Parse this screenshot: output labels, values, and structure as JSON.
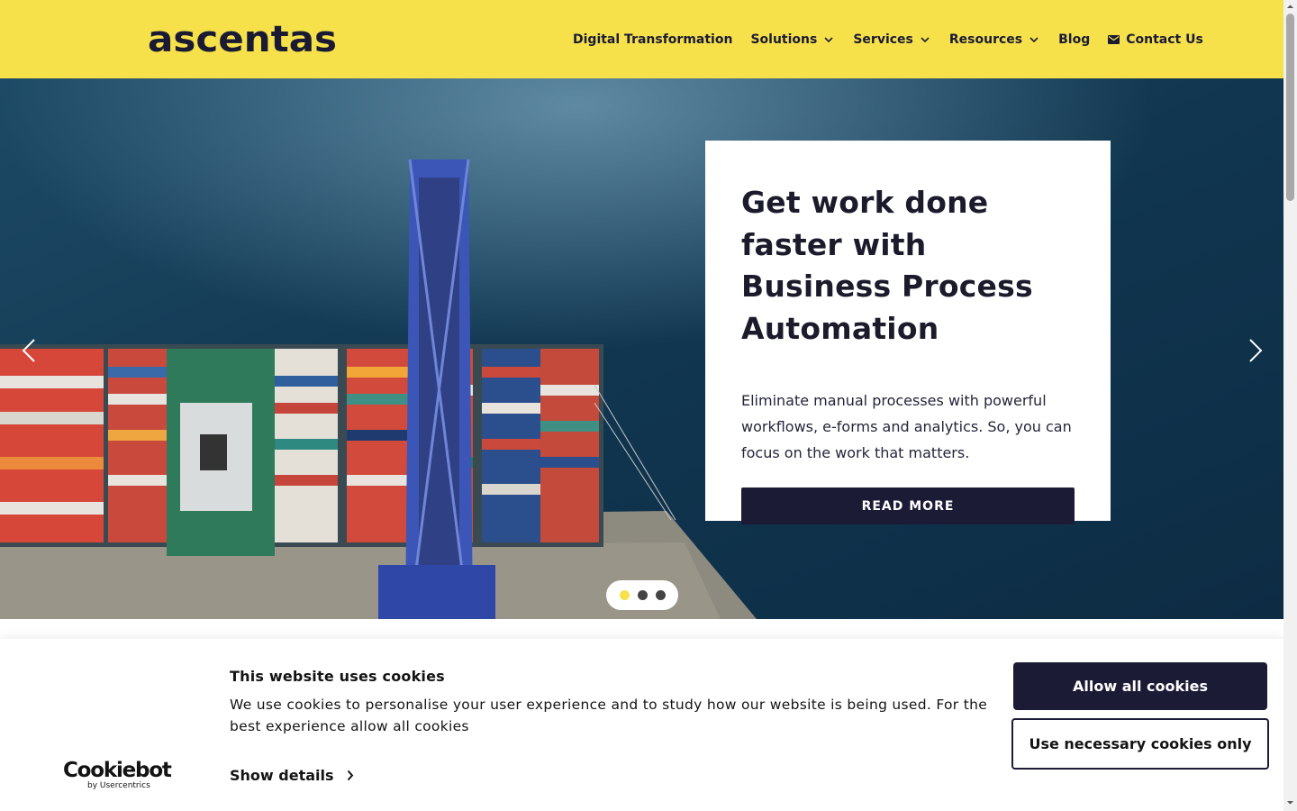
{
  "header": {
    "logo": "ascentas",
    "nav": [
      {
        "label": "Digital Transformation",
        "dropdown": false
      },
      {
        "label": "Solutions",
        "dropdown": true
      },
      {
        "label": "Services",
        "dropdown": true
      },
      {
        "label": "Resources",
        "dropdown": true
      },
      {
        "label": "Blog",
        "dropdown": false
      },
      {
        "label": "Contact Us",
        "icon": "mail-icon"
      }
    ]
  },
  "hero": {
    "title": "Get work done faster with Business Process Automation",
    "text": "Eliminate manual processes with powerful workflows, e-forms and analytics. So, you can focus on the work that matters.",
    "button": "READ MORE",
    "slide_count": 3,
    "active_slide": 1
  },
  "cookie_banner": {
    "brand": "Cookiebot",
    "brand_sub": "by Usercentrics",
    "title": "This website uses cookies",
    "text": "We use cookies to personalise your user experience and to study how our website is being used. For the best experience allow all cookies",
    "details_link": "Show details",
    "allow_all": "Allow all cookies",
    "necessary_only": "Use necessary cookies only"
  },
  "colors": {
    "brand_yellow": "#f6e14b",
    "navy": "#1b1b36"
  }
}
